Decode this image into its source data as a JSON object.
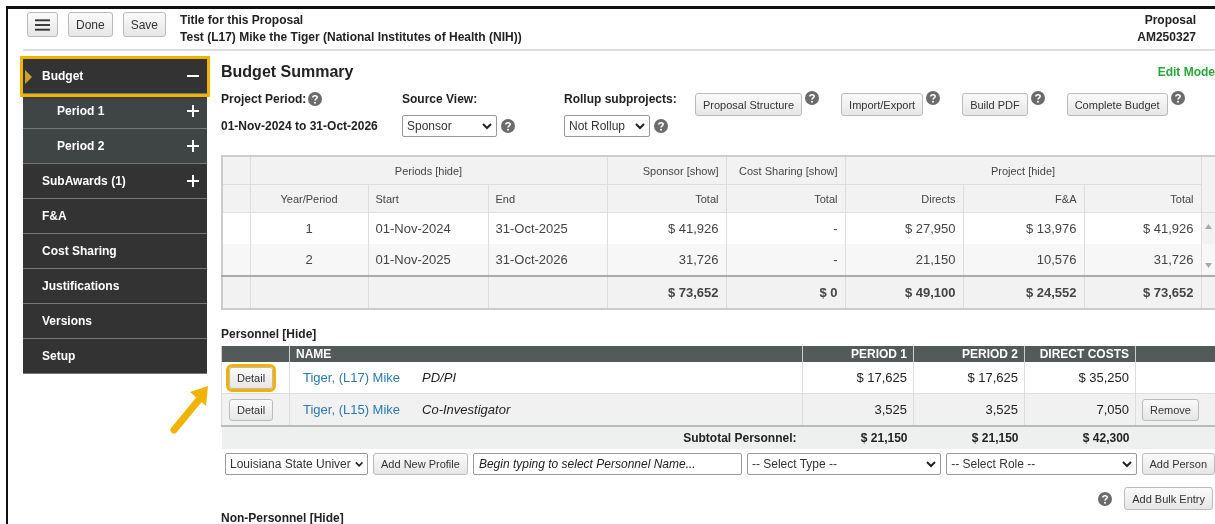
{
  "header": {
    "buttons": [
      "Done",
      "Save"
    ],
    "title_label": "Title for this Proposal",
    "title": "Test (L17) Mike the Tiger (National Institutes of Health (NIH))",
    "proposal_label": "Proposal",
    "proposal_number": "AM250327"
  },
  "sidebar": {
    "items": [
      {
        "label": "Budget",
        "selected": true,
        "highlighted": true,
        "expanded": true,
        "children": [
          {
            "label": "Period 1",
            "selected": false,
            "expanded": false
          },
          {
            "label": "Period 2",
            "selected": false,
            "expanded": false
          }
        ]
      },
      {
        "label": "SubAwards (1)",
        "selected": false,
        "expanded": false
      },
      {
        "label": "F&A",
        "selected": false
      },
      {
        "label": "Cost Sharing",
        "selected": false
      },
      {
        "label": "Justifications",
        "selected": false
      },
      {
        "label": "Versions",
        "selected": false
      },
      {
        "label": "Setup",
        "selected": false
      }
    ]
  },
  "summary": {
    "heading": "Budget Summary",
    "mode": "Edit Mode",
    "project_period_label": "Project Period:",
    "project_period": "01-Nov-2024 to 31-Oct-2026",
    "source_view": {
      "label": "Source View:",
      "value": "Sponsor"
    },
    "rollup": {
      "label": "Rollup subprojects:",
      "value": "Not Rollup"
    },
    "buttons": [
      "Proposal Structure",
      "Import/Export",
      "Build PDF",
      "Complete Budget"
    ]
  },
  "periods_table": {
    "groups": [
      {
        "label": "Periods [hide]",
        "columns": [
          "Year/Period",
          "Start",
          "End"
        ]
      },
      {
        "label": "Sponsor [show]",
        "columns": [
          "Total"
        ]
      },
      {
        "label": "Cost Sharing [show]",
        "columns": [
          "Total"
        ]
      },
      {
        "label": "Project [hide]",
        "columns": [
          "Directs",
          "F&A",
          "Total"
        ]
      }
    ],
    "rows": [
      [
        "1",
        "01-Nov-2024",
        "31-Oct-2025",
        "$ 41,926",
        "-",
        "$ 27,950",
        "$ 13,976",
        "$ 41,926"
      ],
      [
        "2",
        "01-Nov-2025",
        "31-Oct-2026",
        "31,726",
        "-",
        "21,150",
        "10,576",
        "31,726"
      ]
    ],
    "totals": [
      "$ 73,652",
      "$ 0",
      "$ 49,100",
      "$ 24,552",
      "$ 73,652"
    ]
  },
  "personnel": {
    "heading": "Personnel [Hide]",
    "columns": [
      "NAME",
      "PERIOD 1",
      "PERIOD 2",
      "DIRECT COSTS"
    ],
    "rows": [
      {
        "detail": "Detail",
        "highlighted": true,
        "name": "Tiger, (L17) Mike",
        "role": "PD/PI",
        "values": [
          "$ 17,625",
          "$ 17,625",
          "$ 35,250"
        ]
      },
      {
        "detail": "Detail",
        "highlighted": false,
        "name": "Tiger, (L15) Mike",
        "role": "Co-Investigator",
        "values": [
          "3,525",
          "3,525",
          "7,050"
        ],
        "action": "Remove"
      }
    ],
    "subtotal": {
      "label": "Subtotal Personnel:",
      "values": [
        "$ 21,150",
        "$ 21,150",
        "$ 42,300"
      ]
    },
    "add_row": {
      "organization": "Louisiana State Univer",
      "add_profile": "Add New Profile",
      "name_placeholder": "Begin typing to select Personnel Name...",
      "type": "-- Select Type --",
      "role": "-- Select Role --",
      "add_person": "Add Person"
    },
    "bulk_button": "Add Bulk Entry"
  },
  "non_personnel": {
    "heading": "Non-Personnel [Hide]"
  }
}
